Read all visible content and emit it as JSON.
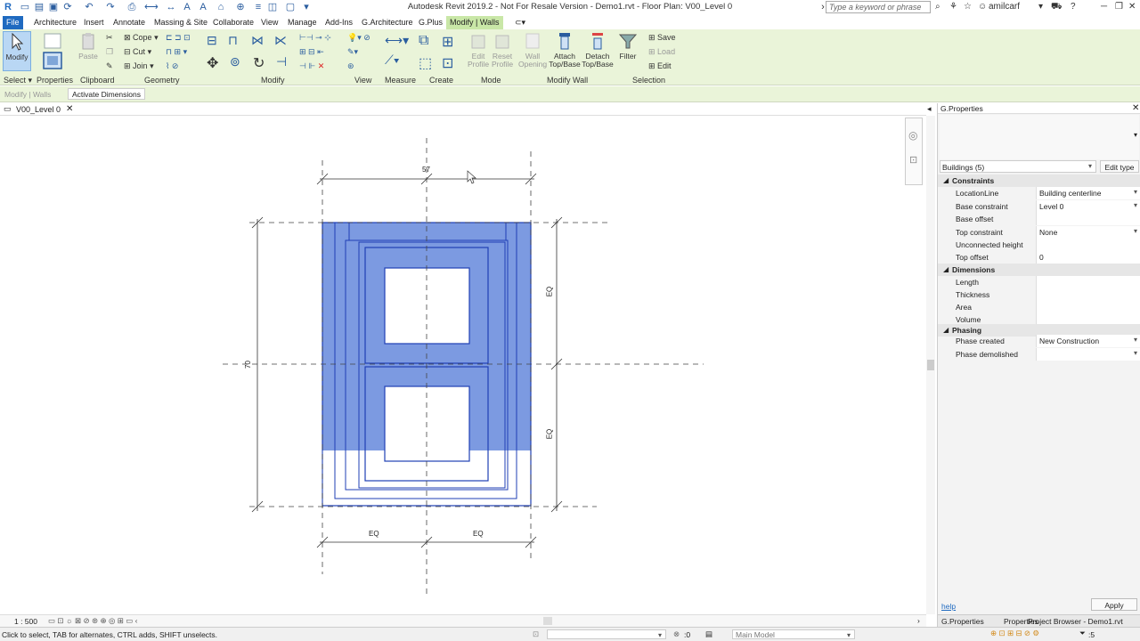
{
  "app": {
    "title": "Autodesk Revit 2019.2 - Not For Resale Version - Demo1.rvt - Floor Plan: V00_Level 0",
    "logo": "R",
    "search_placeholder": "Type a keyword or phrase",
    "user": "amilcarf"
  },
  "tabs": [
    "File",
    "Architecture",
    "Insert",
    "Annotate",
    "Massing & Site",
    "Collaborate",
    "View",
    "Manage",
    "Add-Ins",
    "G.Architecture",
    "G.Plus",
    "Modify | Walls"
  ],
  "ribbon": {
    "modify_label": "Modify",
    "properties_label": "Properties",
    "paste_label": "Paste",
    "cope_label": "Cope",
    "cut_label": "Cut",
    "join_label": "Join",
    "wall_opening_label": "Wall Opening",
    "edit_profile_label": "Edit Profile",
    "reset_profile_label": "Reset Profile",
    "attach_label": "Attach Top/Base",
    "detach_label": "Detach Top/Base",
    "filter_label": "Filter",
    "save_label": "Save",
    "load_label": "Load",
    "edit_label": "Edit",
    "groups": {
      "select": "Select",
      "properties": "Properties",
      "clipboard": "Clipboard",
      "geometry": "Geometry",
      "modify": "Modify",
      "view": "View",
      "measure": "Measure",
      "create": "Create",
      "mode": "Mode",
      "modify_wall": "Modify Wall",
      "selection": "Selection"
    }
  },
  "optionsbar": {
    "context": "Modify | Walls",
    "activate_dimensions": "Activate Dimensions"
  },
  "view_tab": {
    "label": "V00_Level 0"
  },
  "drawing": {
    "dim_top": "57",
    "dim_left": "70",
    "dim_right_top": "EQ",
    "dim_right_bottom": "EQ",
    "dim_bottom_left": "EQ",
    "dim_bottom_right": "EQ"
  },
  "properties": {
    "panel_title": "G.Properties",
    "type_selector": "Buildings (5)",
    "edit_type": "Edit type",
    "sections": {
      "constraints": "Constraints",
      "dimensions": "Dimensions",
      "phasing": "Phasing"
    },
    "rows": {
      "location_line": {
        "label": "LocationLine",
        "value": "Building centerline"
      },
      "base_constraint": {
        "label": "Base constraint",
        "value": "Level 0"
      },
      "base_offset": {
        "label": "Base offset",
        "value": ""
      },
      "top_constraint": {
        "label": "Top constraint",
        "value": "None"
      },
      "unconnected_height": {
        "label": "Unconnected height",
        "value": ""
      },
      "top_offset": {
        "label": "Top offset",
        "value": "0"
      },
      "length": {
        "label": "Length",
        "value": ""
      },
      "thickness": {
        "label": "Thickness",
        "value": ""
      },
      "area": {
        "label": "Area",
        "value": ""
      },
      "volume": {
        "label": "Volume",
        "value": ""
      },
      "phase_created": {
        "label": "Phase created",
        "value": "New Construction"
      },
      "phase_demolished": {
        "label": "Phase demolished",
        "value": ""
      }
    },
    "help_link": "help",
    "apply": "Apply",
    "bottom_tabs": [
      "G.Properties",
      "Properties",
      "Project Browser - Demo1.rvt"
    ]
  },
  "viewctrl": {
    "scale": "1 : 500"
  },
  "status": {
    "hint": "Click to select, TAB for alternates, CTRL adds, SHIFT unselects.",
    "workset_count": ":0",
    "model": "Main Model",
    "filter_count": ":5"
  },
  "colors": {
    "accent": "#1f6ac0",
    "ribbon_bg": "#eaf4d9",
    "selection_fill": "#6e8fde",
    "selection_stroke": "#1f3fb5"
  }
}
